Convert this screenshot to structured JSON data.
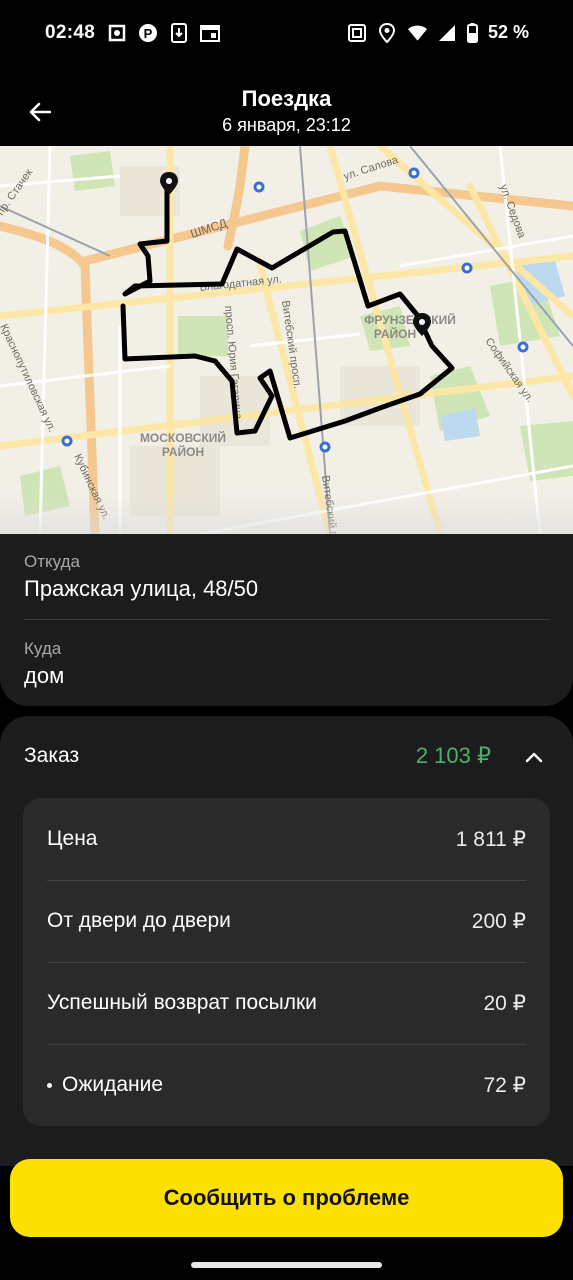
{
  "status_bar": {
    "time": "02:48",
    "battery_percent": "52 %",
    "left_icons": [
      "app-icon",
      "parking-icon",
      "download-icon",
      "calendar-icon"
    ],
    "right_icons": [
      "nfc-icon",
      "location-icon",
      "wifi-icon",
      "signal-icon",
      "battery-icon"
    ]
  },
  "header": {
    "title": "Поездка",
    "subtitle": "6 января, 23:12",
    "back_icon": "arrow-left-icon"
  },
  "map": {
    "labels": {
      "street_salova": "ул. Салова",
      "street_sedova": "ул. Седова",
      "street_stachek": "пр. Стачек",
      "street_kubinskaya": "Кубинская ул.",
      "street_krasnoputilovskaya": "Краснопутиловская ул.",
      "street_blagodatnaya": "Благодатная ул.",
      "street_vitebsky1": "Витебский просп.",
      "street_vitebsky2": "Витебский просп.",
      "street_sofiyskaya": "Софийская ул.",
      "street_yuria": "просп. Юрия Гагарина",
      "street_shmsd": "ШМСД",
      "district_moskovsky_1": "МОСКОВСКИЙ",
      "district_moskovsky_2": "РАЙОН",
      "district_frunzensky_1": "ФРУНЗЕНСКИЙ",
      "district_frunzensky_2": "РАЙОН"
    },
    "route_color": "#000000"
  },
  "addresses": {
    "from_label": "Откуда",
    "from_value": "Пражская улица, 48/50",
    "to_label": "Куда",
    "to_value": "дом"
  },
  "order": {
    "title": "Заказ",
    "total": "2 103 ₽",
    "total_color": "#4bb06a",
    "items": [
      {
        "label": "Цена",
        "value": "1 811 ₽"
      },
      {
        "label": "От двери до двери",
        "value": "200 ₽"
      },
      {
        "label": "Успешный возврат посылки",
        "value": "20 ₽"
      },
      {
        "label": "Ожидание",
        "value": "72 ₽"
      }
    ]
  },
  "report_button": {
    "label": "Сообщить о проблеме",
    "color": "#fce000"
  }
}
